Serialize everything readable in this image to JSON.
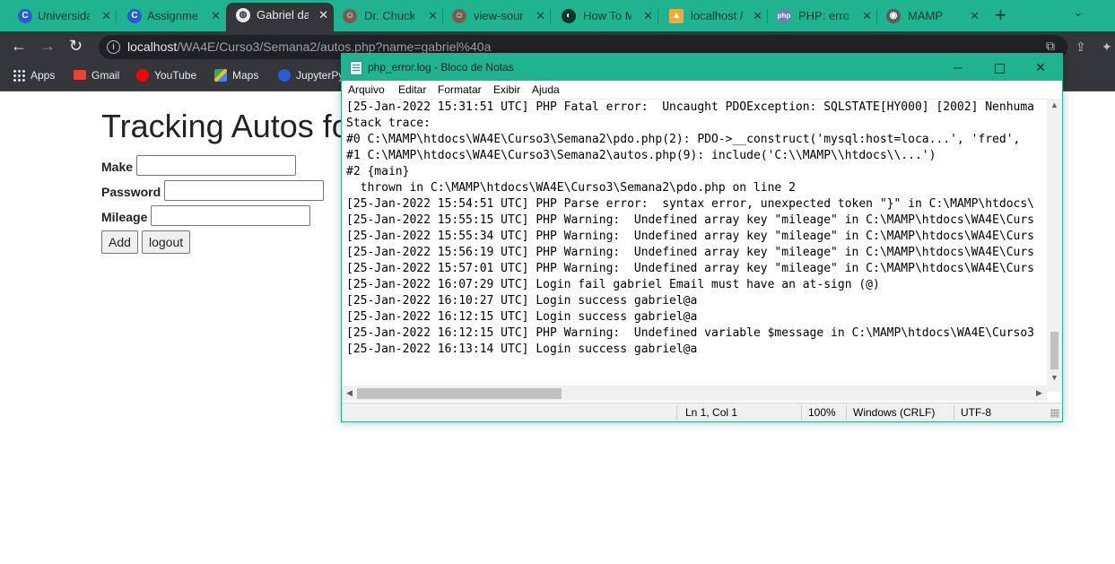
{
  "browser": {
    "tabs": [
      {
        "title": "Universida",
        "icon": "c-logo-icon",
        "active": false
      },
      {
        "title": "Assignmen",
        "icon": "c-logo-icon",
        "active": false
      },
      {
        "title": "Gabriel da",
        "icon": "globe-icon",
        "active": true
      },
      {
        "title": "Dr. Chuck",
        "icon": "avatar-icon",
        "active": false
      },
      {
        "title": "view-sourc",
        "icon": "avatar-icon",
        "active": false
      },
      {
        "title": "How To M",
        "icon": "digitalocean-icon",
        "active": false
      },
      {
        "title": "localhost /",
        "icon": "phpmyadmin-icon",
        "active": false
      },
      {
        "title": "PHP: error",
        "icon": "php-icon",
        "active": false
      },
      {
        "title": "MAMP",
        "icon": "mamp-icon",
        "active": false
      }
    ],
    "url": {
      "host": "localhost",
      "path": "/WA4E/Curso3/Semana2/autos.php?name=gabriel%40a"
    },
    "bookmarks": [
      {
        "label": "Apps",
        "icon": "apps-grid-icon"
      },
      {
        "label": "Gmail",
        "icon": "gmail-icon"
      },
      {
        "label": "YouTube",
        "icon": "youtube-icon"
      },
      {
        "label": "Maps",
        "icon": "maps-icon"
      },
      {
        "label": "JupyterPy",
        "icon": "c-logo-icon"
      }
    ]
  },
  "page": {
    "title": "Tracking Autos fo",
    "fields": [
      {
        "label": "Make",
        "value": ""
      },
      {
        "label": "Password",
        "value": ""
      },
      {
        "label": "Mileage",
        "value": ""
      }
    ],
    "buttons": {
      "add": "Add",
      "logout": "logout"
    }
  },
  "notepad": {
    "title": "php_error.log - Bloco de Notas",
    "menu": [
      "Arquivo",
      "Editar",
      "Formatar",
      "Exibir",
      "Ajuda"
    ],
    "lines": [
      "[25-Jan-2022 15:31:51 UTC] PHP Fatal error:  Uncaught PDOException: SQLSTATE[HY000] [2002] Nenhuma",
      "Stack trace:",
      "#0 C:\\MAMP\\htdocs\\WA4E\\Curso3\\Semana2\\pdo.php(2): PDO->__construct('mysql:host=loca...', 'fred',",
      "#1 C:\\MAMP\\htdocs\\WA4E\\Curso3\\Semana2\\autos.php(9): include('C:\\\\MAMP\\\\htdocs\\\\...')",
      "#2 {main}",
      "  thrown in C:\\MAMP\\htdocs\\WA4E\\Curso3\\Semana2\\pdo.php on line 2",
      "[25-Jan-2022 15:54:51 UTC] PHP Parse error:  syntax error, unexpected token \"}\" in C:\\MAMP\\htdocs\\",
      "[25-Jan-2022 15:55:15 UTC] PHP Warning:  Undefined array key \"mileage\" in C:\\MAMP\\htdocs\\WA4E\\Curs",
      "[25-Jan-2022 15:55:34 UTC] PHP Warning:  Undefined array key \"mileage\" in C:\\MAMP\\htdocs\\WA4E\\Curs",
      "[25-Jan-2022 15:56:19 UTC] PHP Warning:  Undefined array key \"mileage\" in C:\\MAMP\\htdocs\\WA4E\\Curs",
      "[25-Jan-2022 15:57:01 UTC] PHP Warning:  Undefined array key \"mileage\" in C:\\MAMP\\htdocs\\WA4E\\Curs",
      "[25-Jan-2022 16:07:29 UTC] Login fail gabriel Email must have an at-sign (@)",
      "[25-Jan-2022 16:10:27 UTC] Login success gabriel@a",
      "[25-Jan-2022 16:12:15 UTC] Login success gabriel@a",
      "[25-Jan-2022 16:12:15 UTC] PHP Warning:  Undefined variable $message in C:\\MAMP\\htdocs\\WA4E\\Curso3",
      "[25-Jan-2022 16:13:14 UTC] Login success gabriel@a"
    ],
    "status": {
      "position": "Ln 1, Col 1",
      "zoom": "100%",
      "line_ending": "Windows (CRLF)",
      "encoding": "UTF-8"
    }
  },
  "colors": {
    "accent": "#1fb48f",
    "toolbar": "#35363a",
    "omnibox": "#202124"
  }
}
